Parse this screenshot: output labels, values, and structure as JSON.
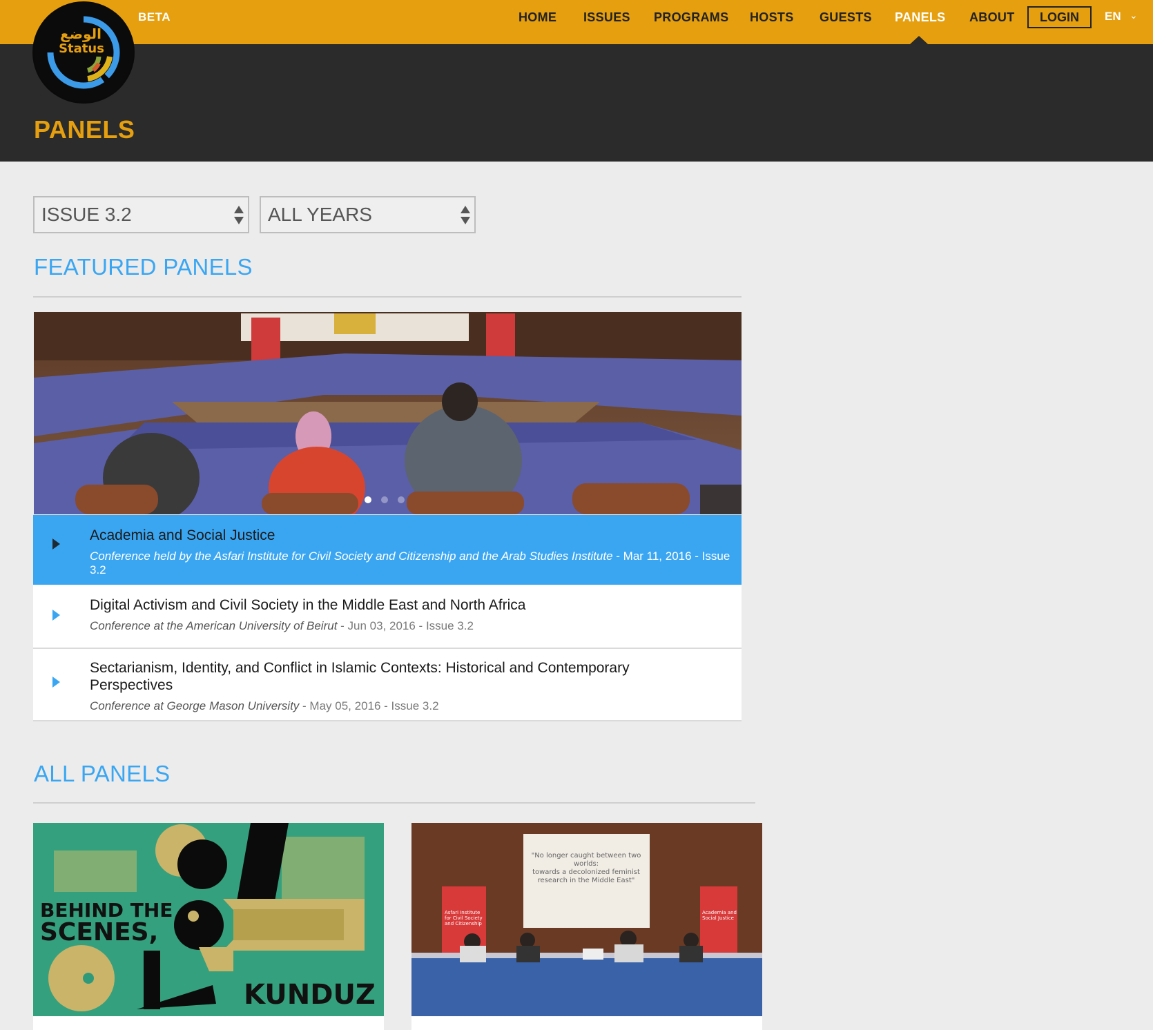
{
  "site": {
    "beta_label": "BETA",
    "logo": {
      "text_ar": "الوضع",
      "text_en": "Status"
    }
  },
  "nav": {
    "items": [
      {
        "label": "HOME",
        "active": false
      },
      {
        "label": "ISSUES",
        "active": false
      },
      {
        "label": "PROGRAMS",
        "active": false
      },
      {
        "label": "HOSTS",
        "active": false
      },
      {
        "label": "GUESTS",
        "active": false
      },
      {
        "label": "PANELS",
        "active": true
      },
      {
        "label": "ABOUT",
        "active": false
      }
    ],
    "login_label": "LOGIN",
    "language": "EN",
    "language_icon": "chevron-down-icon"
  },
  "page": {
    "title": "PANELS"
  },
  "filters": {
    "issue": {
      "selected": "ISSUE 3.2"
    },
    "year": {
      "selected": "ALL YEARS"
    }
  },
  "featured": {
    "heading": "FEATURED PANELS",
    "slider": {
      "slide_count": 3,
      "active_index": 0
    },
    "items": [
      {
        "title": "Academia and Social Justice",
        "venue": "Conference held by the Asfari Institute for Civil Society and Citizenship and the Arab Studies Institute",
        "date": " - Mar 11, 2016 - ",
        "issue": "Issue 3.2",
        "active": true
      },
      {
        "title": "Digital Activism and Civil Society in the Middle East and North Africa",
        "venue": "Conference at the American University of Beirut",
        "date": " - Jun 03, 2016 - ",
        "issue": "Issue 3.2",
        "active": false
      },
      {
        "title": "Sectarianism, Identity, and Conflict in Islamic Contexts: Historical and Contemporary Perspectives",
        "venue": "Conference at George Mason University",
        "date": " - May 05, 2016 - ",
        "issue": "Issue 3.2",
        "active": false
      }
    ]
  },
  "all_panels": {
    "heading": "ALL PANELS",
    "cards": [
      {
        "image_text": [
          "BEHIND THE",
          "SCENES,",
          "KUNDUZ"
        ]
      },
      {
        "banner_lines": [
          "\"No longer caught between two",
          "worlds:",
          "towards a decolonized feminist",
          "research in the Middle East\""
        ],
        "roll_up_left": [
          "Asfari Institute",
          "for Civil Society",
          "and Citizenship"
        ],
        "roll_up_right": [
          "Academia and",
          "Social Justice"
        ]
      }
    ]
  },
  "colors": {
    "brand_orange": "#e59f0f",
    "accent_blue": "#3aa6f2",
    "dark_band": "#2b2b2b",
    "page_bg": "#ececec"
  }
}
